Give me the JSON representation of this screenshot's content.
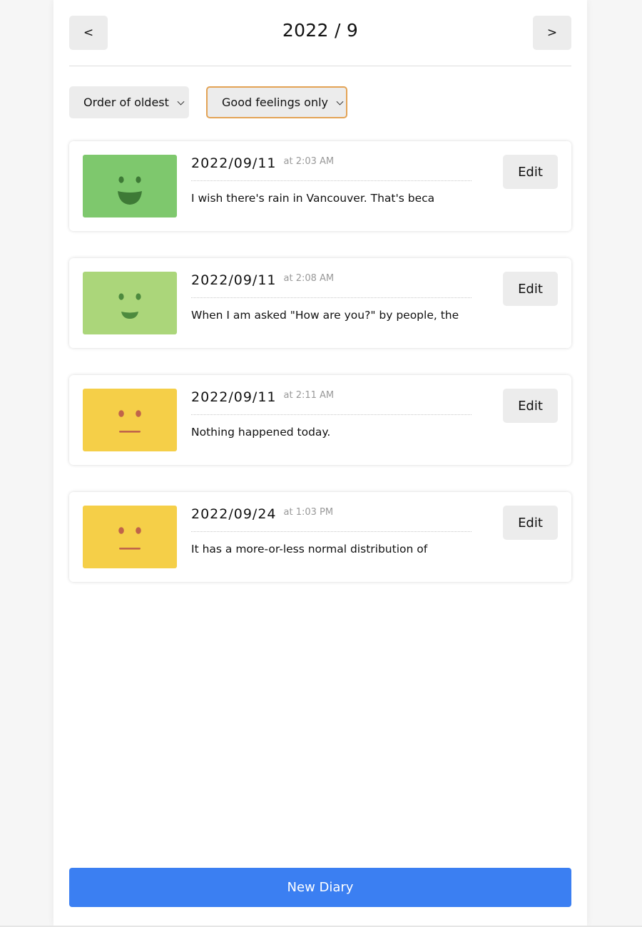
{
  "header": {
    "title": "2022 / 9",
    "prev_label": "<",
    "next_label": ">"
  },
  "filters": {
    "order": {
      "selected": "Order of oldest"
    },
    "emotion": {
      "selected": "Good feelings only",
      "focus_color": "#e3a355"
    }
  },
  "diaries": [
    {
      "date": "2022/09/11",
      "time": "at 2:03 AM",
      "content": "I wish there's rain in Vancouver. That's beca",
      "emotion_icon": "big-smile-face-icon",
      "emotion_color": "#7ec86d",
      "edit_label": "Edit"
    },
    {
      "date": "2022/09/11",
      "time": "at 2:08 AM",
      "content": "When I am asked \"How are you?\" by people, the",
      "emotion_icon": "smile-face-icon",
      "emotion_color": "#abd67a",
      "edit_label": "Edit"
    },
    {
      "date": "2022/09/11",
      "time": "at 2:11 AM",
      "content": "Nothing happened today.",
      "emotion_icon": "neutral-face-icon",
      "emotion_color": "#f5cf48",
      "edit_label": "Edit"
    },
    {
      "date": "2022/09/24",
      "time": "at 1:03 PM",
      "content": "It has a more-or-less normal distribution of",
      "emotion_icon": "neutral-face-icon",
      "emotion_color": "#f5cf48",
      "edit_label": "Edit"
    }
  ],
  "footer": {
    "new_label": "New Diary",
    "accent": "#3b7ff2"
  }
}
